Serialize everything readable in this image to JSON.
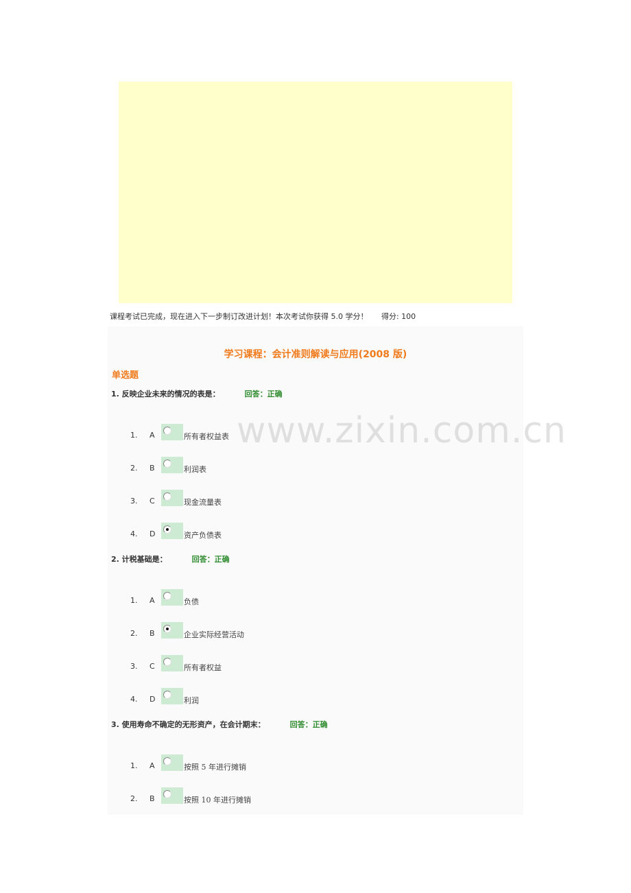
{
  "status": {
    "message": "课程考试已完成，现在进入下一步制订改进计划！本次考试你获得 5.0 学分！",
    "score": "得分: 100"
  },
  "course": {
    "title": "学习课程：会计准则解读与应用(2008 版)"
  },
  "section": {
    "title": "单选题"
  },
  "questions": [
    {
      "text": "1. 反映企业未来的情况的表是：",
      "answer": "回答：正确",
      "options": [
        {
          "num": "1.",
          "letter": "A",
          "text": "所有者权益表",
          "checked": false
        },
        {
          "num": "2.",
          "letter": "B",
          "text": "利润表",
          "checked": false
        },
        {
          "num": "3.",
          "letter": "C",
          "text": "现金流量表",
          "checked": false
        },
        {
          "num": "4.",
          "letter": "D",
          "text": "资产负债表",
          "checked": true
        }
      ]
    },
    {
      "text": "2. 计税基础是：",
      "answer": "回答：正确",
      "options": [
        {
          "num": "1.",
          "letter": "A",
          "text": "负债",
          "checked": false
        },
        {
          "num": "2.",
          "letter": "B",
          "text": "企业实际经营活动",
          "checked": true
        },
        {
          "num": "3.",
          "letter": "C",
          "text": "所有者权益",
          "checked": false
        },
        {
          "num": "4.",
          "letter": "D",
          "text": "利润",
          "checked": false
        }
      ]
    },
    {
      "text": "3. 使用寿命不确定的无形资产，在会计期末：",
      "answer": "回答：正确",
      "options": [
        {
          "num": "1.",
          "letter": "A",
          "text": "按照 5 年进行摊销",
          "checked": false
        },
        {
          "num": "2.",
          "letter": "B",
          "text": "按照 10 年进行摊销",
          "checked": false
        }
      ]
    }
  ],
  "watermark": "www.zixin.com.cn",
  "colors": {
    "accent": "#f07b1c",
    "correct": "#2e8b2e",
    "panel": "#ffffcc",
    "radio_bg": "#cdebd3"
  }
}
